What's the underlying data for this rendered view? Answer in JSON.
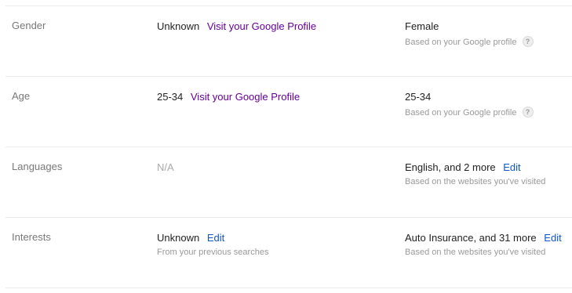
{
  "rows": [
    {
      "label": "Gender",
      "col2": {
        "value": "Unknown",
        "link": "Visit your Google Profile"
      },
      "col3": {
        "value": "Female",
        "note": "Based on your Google profile",
        "help_icon": "?"
      }
    },
    {
      "label": "Age",
      "col2": {
        "value": "25-34",
        "link": "Visit your Google Profile"
      },
      "col3": {
        "value": "25-34",
        "note": "Based on your Google profile",
        "help_icon": "?"
      }
    },
    {
      "label": "Languages",
      "col2": {
        "value": "N/A"
      },
      "col3": {
        "value": "English, and 2 more",
        "edit": "Edit",
        "note": "Based on the websites you've visited"
      }
    },
    {
      "label": "Interests",
      "col2": {
        "value": "Unknown",
        "edit": "Edit",
        "note": "From your previous searches"
      },
      "col3": {
        "value": "Auto Insurance, and 31 more",
        "edit": "Edit",
        "note": "Based on the websites you've visited"
      }
    }
  ],
  "colors": {
    "label": "#777777",
    "profile_link": "#660099",
    "edit_link": "#1155cc",
    "note": "#999999",
    "divider": "#ebebeb"
  }
}
